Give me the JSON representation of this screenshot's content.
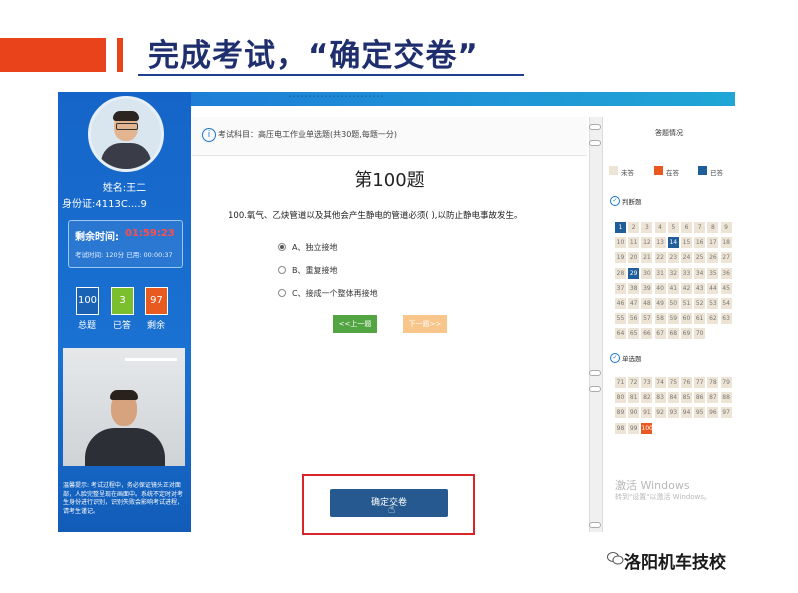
{
  "slide": {
    "title": "完成考试，“确定交卷”",
    "brand": "洛阳机车技校"
  },
  "exam": {
    "banner_text": "……………………",
    "candidate": {
      "name": "姓名:王二",
      "id": "身份证:4113C....9"
    },
    "timer": {
      "label": "剩余时间:",
      "value": "01:59:23",
      "detail": "考试时间: 120分  已用: 00:00:37"
    },
    "stats": [
      {
        "label": "总题",
        "value": "100",
        "color": "#1a63b4"
      },
      {
        "label": "已答",
        "value": "3",
        "color": "#7cbf2e"
      },
      {
        "label": "剩余",
        "value": "97",
        "color": "#e85a1f"
      }
    ],
    "tip": "温馨提示: 考试过程中，务必保证镜头正对面部，人脸完整呈现在画面中。系统不定时对考生身份进行识别，识别失败会影响考试进程，请考生谨记。",
    "subject": "考试科目：高压电工作业单选题(共30题,每题一分)",
    "question_number": "第100题",
    "question_text": "100.氧气、乙炔管道以及其他会产生静电的管道必须( ),以防止静电事故发生。",
    "options": [
      {
        "text": "A、独立接地",
        "selected": true
      },
      {
        "text": "B、重复接地",
        "selected": false
      },
      {
        "text": "C、接成一个整体再接地",
        "selected": false
      }
    ],
    "prev_label": "<<上一题",
    "next_label": "下一题>>",
    "submit_label": "确定交卷"
  },
  "answer_card": {
    "title": "答题情况",
    "legend": [
      {
        "label": "未答",
        "color": "#eee4d6"
      },
      {
        "label": "在答",
        "color": "#e8581f"
      },
      {
        "label": "已答",
        "color": "#1f5e99"
      }
    ],
    "sections": [
      {
        "title": "判断题",
        "start": 1,
        "end": 70,
        "answered": [
          1,
          14,
          29
        ],
        "current": []
      },
      {
        "title": "单选题",
        "start": 71,
        "end": 100,
        "answered": [],
        "current": [
          100
        ]
      }
    ],
    "watermark_title": "激活 Windows",
    "watermark_sub": "转到\"设置\"以激活 Windows。"
  }
}
